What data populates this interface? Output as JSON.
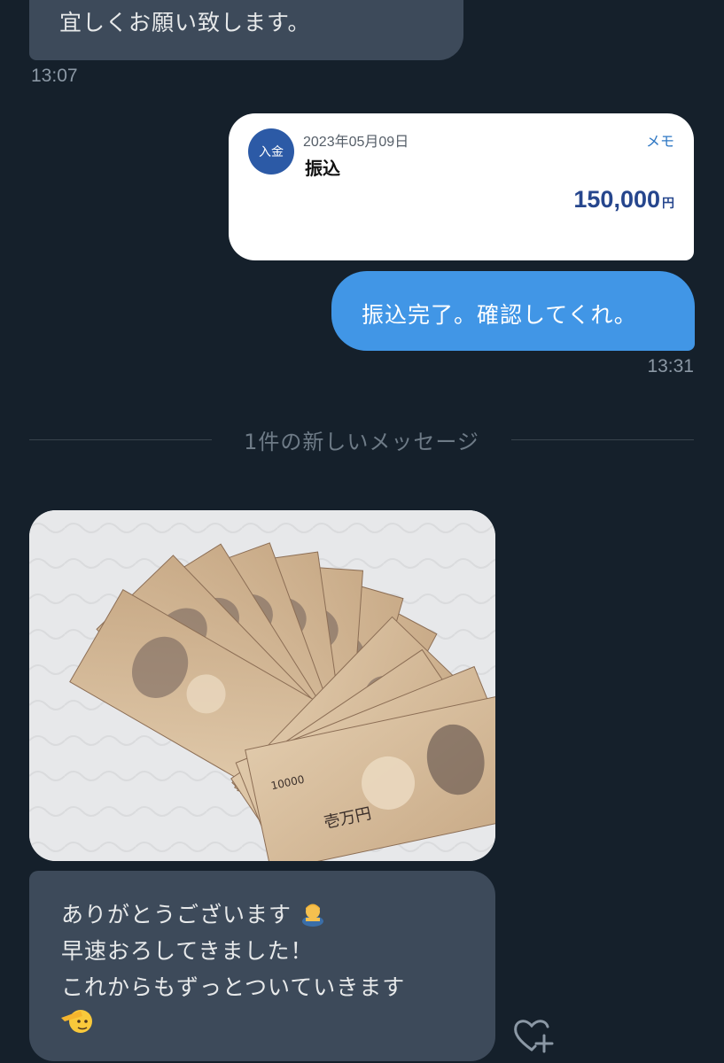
{
  "messages": {
    "first_incoming": {
      "text": "宜しくお願い致します。",
      "time": "13:07"
    },
    "transfer_card": {
      "badge": "入金",
      "date": "2023年05月09日",
      "memo_label": "メモ",
      "type": "振込",
      "amount": "150,000",
      "currency_unit": "円"
    },
    "outgoing": {
      "text": "振込完了。確認してくれ。",
      "time": "13:31"
    },
    "new_messages_divider": "1件の新しいメッセージ",
    "photo": {
      "subject": "fanned stack of 10000 yen banknotes",
      "note_denomination": "10000",
      "note_title": "壱万円"
    },
    "last_incoming": {
      "lines": [
        "ありがとうございます",
        "早速おろしてきました！",
        "これからもずっとついていきます"
      ],
      "emoji_1": "person-bowing-emoji",
      "emoji_2": "saluting-face-emoji"
    }
  },
  "icons": {
    "reaction": "heart-add-icon"
  },
  "colors": {
    "background": "#15202b",
    "incoming_bubble": "#3d4a5a",
    "outgoing_bubble": "#4196e6",
    "badge": "#2c5aa6",
    "amount": "#26468d"
  }
}
